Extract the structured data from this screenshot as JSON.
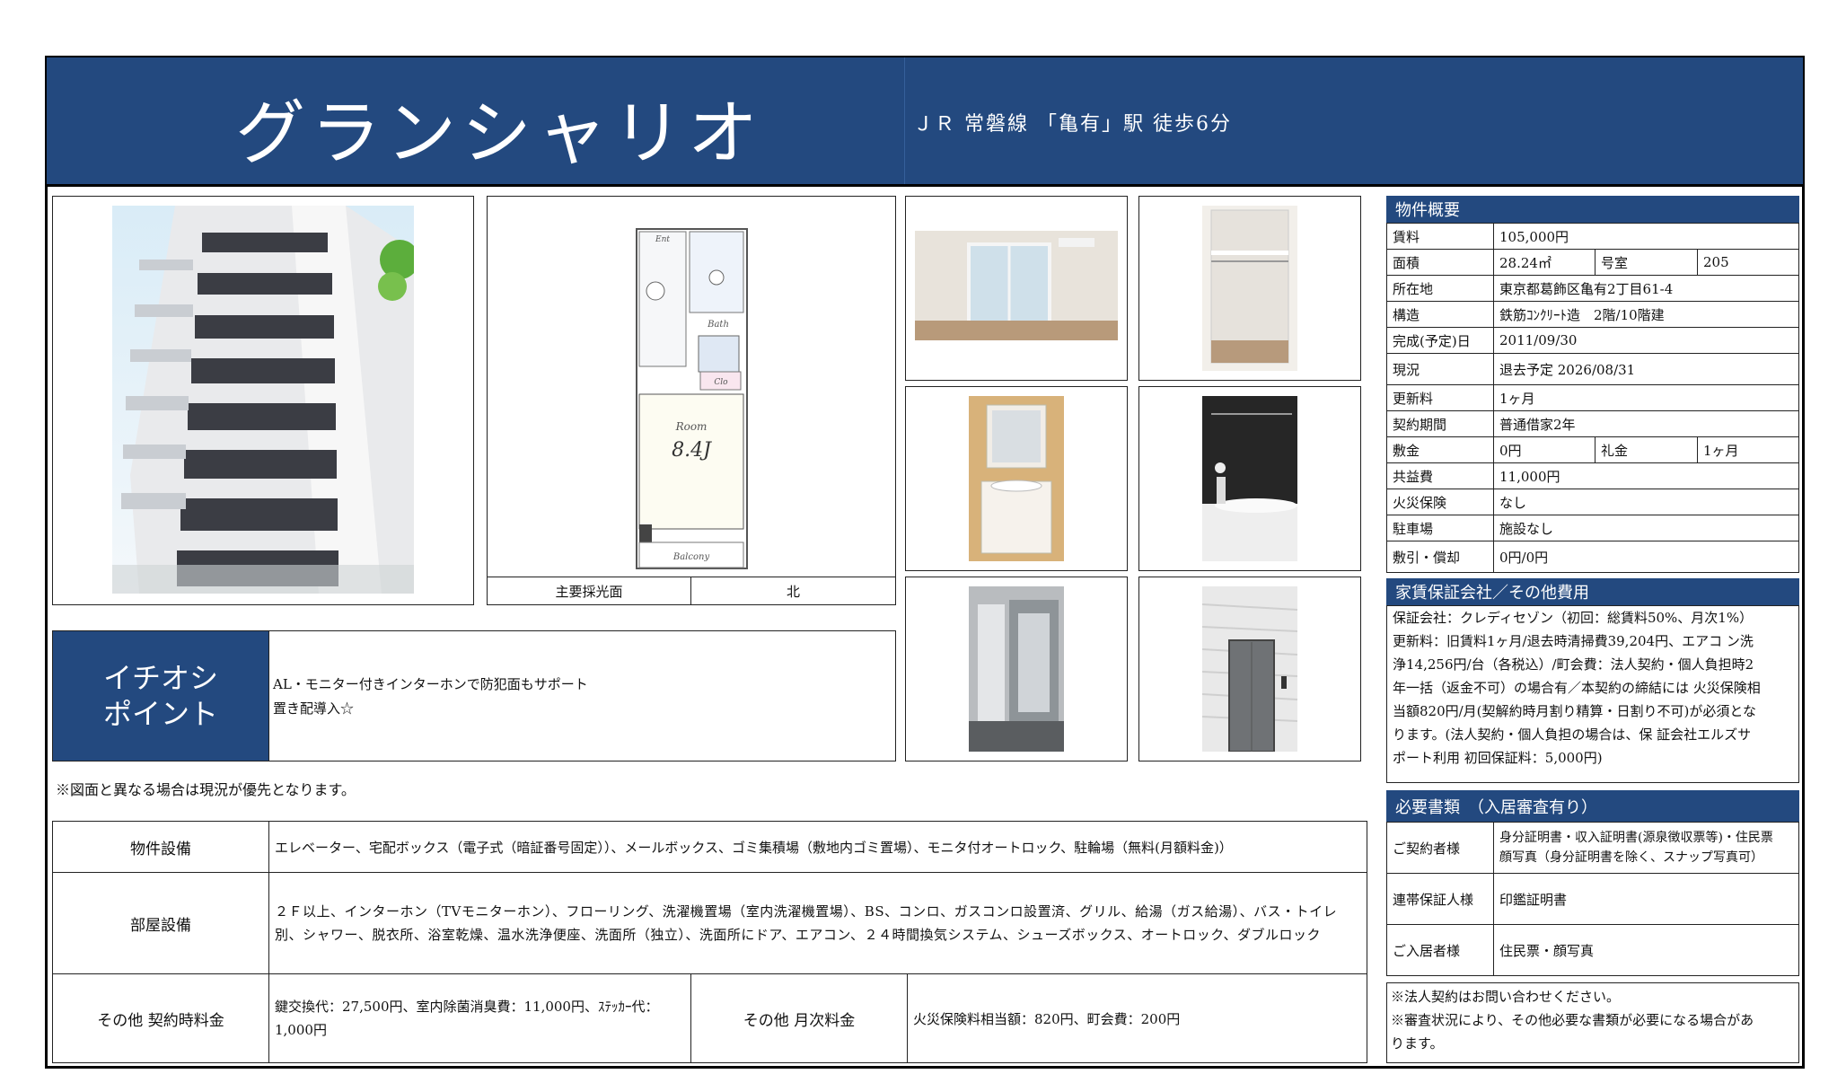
{
  "header": {
    "title": "グランシャリオ",
    "station": "ＪＲ 常磐線 「亀有」駅 徒歩6分"
  },
  "floorplan": {
    "room_label": "Room",
    "room_size": "8.4J",
    "balcony_label": "Balcony",
    "bath_label": "Bath",
    "ent_label": "Ent",
    "clo_label": "Clo",
    "main_light_label": "主要採光面",
    "main_light_value": "北"
  },
  "pr": {
    "label_line1": "イチオシ",
    "label_line2": "ポイント",
    "text_line1": "AL・モニター付きインターホンで防犯面もサポート",
    "text_line2": "置き配導入☆"
  },
  "note": "※図面と異なる場合は現況が優先となります。",
  "facilities": [
    {
      "label": "物件設備",
      "value": "エレベーター、宅配ボックス（電子式（暗証番号固定））、メールボックス、ゴミ集積場（敷地内ゴミ置場）、モニタ付オートロック、駐輪場（無料(月額料金)）"
    },
    {
      "label": "部屋設備",
      "value": "２Ｆ以上、インターホン（TVモニターホン）、フローリング、洗濯機置場（室内洗濯機置場）、BS、コンロ、ガスコンロ設置済、グリル、給湯（ガス給湯）、バス・トイレ別、シャワー、脱衣所、浴室乾燥、温水洗浄便座、洗面所（独立）、洗面所にドア、エアコン、２４時間換気システム、シューズボックス、オートロック、ダブルロック"
    }
  ],
  "other_fees": {
    "contract_label": "その他 契約時料金",
    "contract_value": "鍵交換代：27,500円、室内除菌消臭費：11,000円、ｽﾃｯｶｰ代：1,000円",
    "monthly_label": "その他 月次料金",
    "monthly_value": "火災保険料相当額：820円、町会費：200円"
  },
  "overview": {
    "title": "物件概要",
    "rent_label": "賃料",
    "rent": "105,000円",
    "area_label": "面積",
    "area": "28.24㎡",
    "room_no_label": "号室",
    "room_no": "205",
    "address_label": "所在地",
    "address": "東京都葛飾区亀有2丁目61-4",
    "structure_label": "構造",
    "structure": "鉄筋ｺﾝｸﾘｰﾄ造　2階/10階建",
    "built_label": "完成(予定)日",
    "built": "2011/09/30",
    "status_label": "現況",
    "status": "退去予定 2026/08/31",
    "renewal_label": "更新料",
    "renewal": "1ヶ月",
    "term_label": "契約期間",
    "term": "普通借家2年",
    "deposit_label": "敷金",
    "deposit": "0円",
    "key_money_label": "礼金",
    "key_money": "1ヶ月",
    "common_label": "共益費",
    "common": "11,000円",
    "fire_label": "火災保険",
    "fire": "なし",
    "parking_label": "駐車場",
    "parking": "施設なし",
    "shikibiki_label": "敷引・償却",
    "shikibiki": "0円/0円"
  },
  "guarantee": {
    "title": "家賃保証会社／その他費用",
    "lines": [
      "保証会社：クレディセゾン（初回：総賃料50%、月次1%）",
      "更新料：旧賃料1ヶ月/退去時清掃費39,204円、エアコ ン洗",
      "浄14,256円/台（各税込）/町会費：法人契約・個人負担時2",
      "年一括（返金不可）の場合有／本契約の締結には 火災保険相",
      "当額820円/月(契解約時月割り精算・日割り不可)が必須とな",
      "ります。(法人契約・個人負担の場合は、保 証会社エルズサ",
      "ポート利用 初回保証料：5,000円)"
    ]
  },
  "documents": {
    "title": "必要書類　（入居審査有り）",
    "rows": [
      {
        "label": "ご契約者様",
        "line1": "身分証明書・収入証明書(源泉徴収票等)・住民票",
        "line2": "顔写真（身分証明書を除く、スナップ写真可）"
      },
      {
        "label": "連帯保証人様",
        "line1": "印鑑証明書",
        "line2": ""
      },
      {
        "label": "ご入居者様",
        "line1": "住民票・顔写真",
        "line2": ""
      }
    ],
    "note1": "※法人契約はお問い合わせください。",
    "note2": "※審査状況により、その他必要な書類が必要になる場合があ",
    "note3": "ります。"
  },
  "colors": {
    "navy": "#23497f",
    "label_bg": "#d8dfeb"
  }
}
